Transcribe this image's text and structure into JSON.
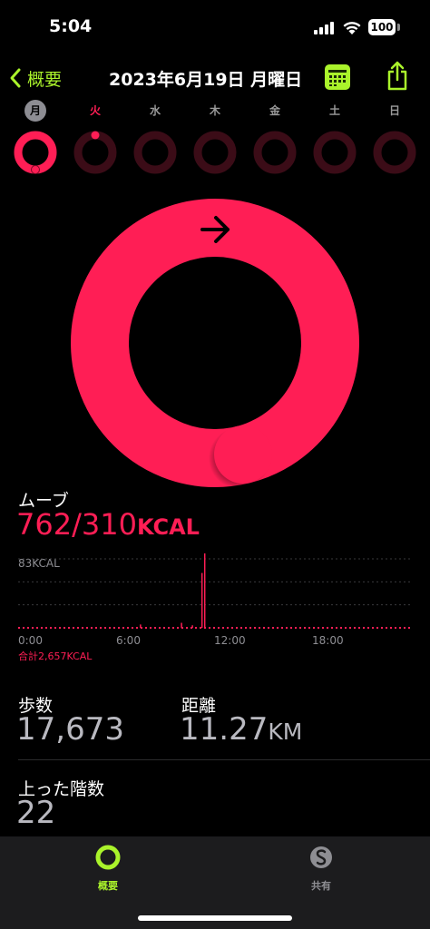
{
  "status_bar": {
    "time": "5:04",
    "battery": "100"
  },
  "nav": {
    "back_label": "概要",
    "title": "2023年6月19日 月曜日"
  },
  "week": {
    "days": [
      {
        "label": "月",
        "progress": 2.46,
        "selected": true
      },
      {
        "label": "火",
        "progress": 0.0,
        "today": true
      },
      {
        "label": "水",
        "progress": 0
      },
      {
        "label": "木",
        "progress": 0
      },
      {
        "label": "金",
        "progress": 0
      },
      {
        "label": "土",
        "progress": 0
      },
      {
        "label": "日",
        "progress": 0
      }
    ]
  },
  "colors": {
    "move": "#ff1e55",
    "move_dim": "#3b0c17",
    "accent": "#aaf32b",
    "tab_inactive": "#8e8e93"
  },
  "move": {
    "label": "ムーブ",
    "value": "762/310",
    "unit": "KCAL",
    "progress": 2.46
  },
  "chart_data": {
    "type": "bar",
    "max_label": "83KCAL",
    "x_ticks": [
      "0:00",
      "6:00",
      "12:00",
      "18:00"
    ],
    "total_label": "合計2,657KCAL",
    "ylim": [
      0,
      83
    ],
    "values": [
      2,
      2,
      2,
      2,
      2,
      2,
      2,
      2,
      2,
      2,
      2,
      2,
      2,
      2,
      2,
      2,
      2,
      2,
      2,
      2,
      2,
      2,
      2,
      2,
      2,
      2,
      2,
      2,
      2,
      2,
      2,
      2,
      2,
      2,
      2,
      2,
      2,
      2,
      2,
      2,
      2,
      2,
      2,
      2,
      2,
      2,
      2,
      2,
      2,
      2,
      2,
      2,
      2,
      2,
      2,
      2,
      2,
      2,
      2,
      2,
      2,
      2,
      2,
      2,
      2,
      2,
      2,
      2,
      2,
      2,
      2,
      2,
      2,
      2,
      2,
      2,
      2,
      2,
      2,
      2,
      2,
      2,
      2,
      2,
      2,
      2,
      2,
      2,
      2,
      4,
      2,
      2,
      2,
      2,
      2,
      2,
      2,
      2,
      2,
      2,
      2,
      2,
      2,
      2,
      2,
      2,
      2,
      2,
      2,
      2,
      2,
      2,
      2,
      2,
      2,
      2,
      2,
      2,
      2,
      6,
      2,
      2,
      2,
      2,
      2,
      2,
      2,
      3,
      2,
      2,
      2,
      2,
      2,
      2,
      66,
      2,
      95,
      2,
      2,
      2,
      2,
      2,
      2,
      2,
      2,
      2,
      2,
      2,
      2,
      2,
      2,
      2,
      2,
      2,
      2,
      2,
      2,
      2,
      2,
      2,
      2,
      2,
      2,
      2,
      2,
      2,
      2,
      2,
      2,
      2,
      2,
      2,
      2,
      2,
      2,
      2,
      2,
      2,
      2,
      2,
      2,
      2,
      2,
      2,
      2,
      2,
      2,
      2,
      2,
      2,
      2,
      2,
      2,
      2,
      2,
      2,
      2,
      2,
      2,
      2,
      2,
      2,
      2,
      2,
      2,
      2,
      2,
      2,
      2,
      2,
      2,
      2,
      2,
      2,
      2,
      2,
      2,
      2,
      2,
      2,
      2,
      2,
      2,
      2,
      2,
      2,
      2,
      2,
      2,
      2,
      2,
      2,
      2,
      2,
      2,
      2,
      2,
      2,
      2,
      2,
      2,
      2,
      2,
      2,
      2,
      2,
      2,
      2,
      2,
      2,
      2,
      2,
      2,
      2,
      2,
      2,
      2,
      2,
      2,
      2,
      2,
      2,
      2,
      2,
      2,
      2,
      2,
      2,
      2,
      2,
      2,
      2,
      2,
      2,
      2,
      2,
      2,
      2,
      2,
      2,
      2,
      2,
      2,
      2,
      2,
      2,
      2,
      2
    ]
  },
  "stats": {
    "steps": {
      "label": "歩数",
      "value": "17,673"
    },
    "distance": {
      "label": "距離",
      "value": "11.27",
      "unit": "KM"
    },
    "floors": {
      "label": "上った階数",
      "value": "22"
    }
  },
  "tabs": [
    {
      "label": "概要",
      "icon": "activity-rings-icon",
      "active": true
    },
    {
      "label": "共有",
      "icon": "sharing-icon",
      "active": false
    }
  ]
}
